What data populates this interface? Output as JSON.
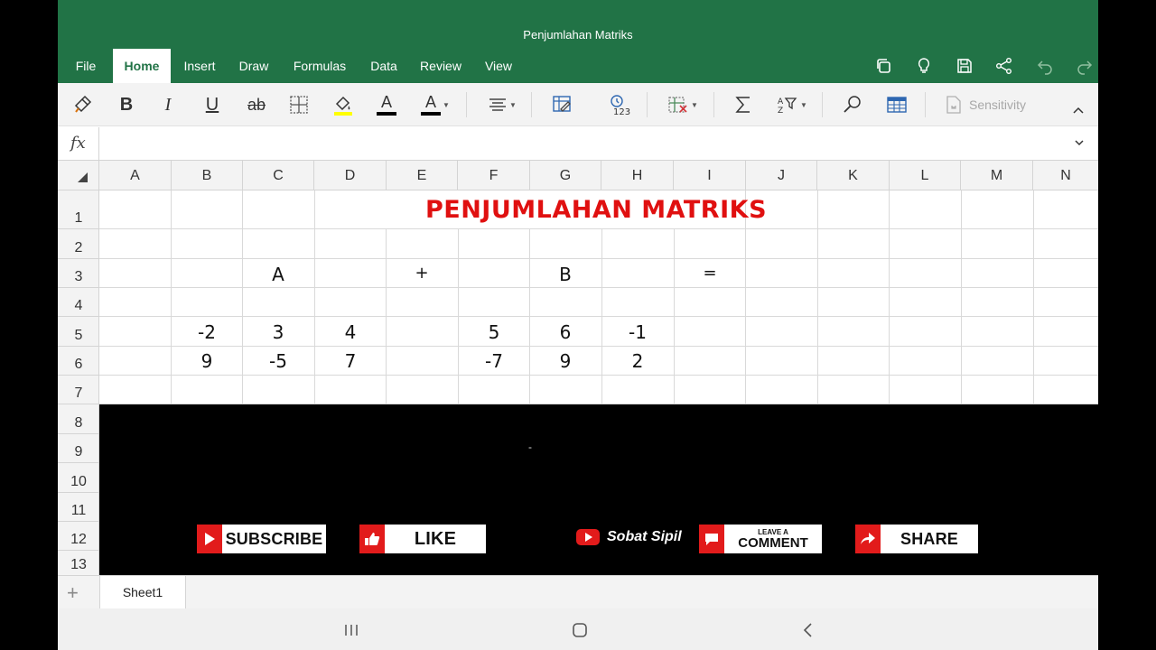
{
  "app": {
    "title": "Penjumlahan Matriks",
    "accent": "#217346"
  },
  "ribbon": {
    "tabs": [
      {
        "label": "File",
        "active": false
      },
      {
        "label": "Home",
        "active": true
      },
      {
        "label": "Insert",
        "active": false
      },
      {
        "label": "Draw",
        "active": false
      },
      {
        "label": "Formulas",
        "active": false
      },
      {
        "label": "Data",
        "active": false
      },
      {
        "label": "Review",
        "active": false
      },
      {
        "label": "View",
        "active": false
      }
    ],
    "right_icons": [
      "copy-icon",
      "lightbulb-icon",
      "save-icon",
      "share-icon",
      "undo-icon",
      "redo-icon"
    ]
  },
  "toolbar": {
    "items": [
      "format-painter-icon",
      "bold-icon",
      "italic-icon",
      "underline-icon",
      "strikethrough-icon",
      "borders-icon",
      "fill-color-icon",
      "font-color-icon",
      "font-color-dropdown-icon",
      "align-icon",
      "wrap-text-icon",
      "number-format-icon",
      "insert-delete-icon",
      "autosum-icon",
      "sort-filter-icon",
      "find-icon",
      "format-as-table-icon",
      "sensitivity-icon",
      "collapse-ribbon-icon"
    ],
    "bold_label": "B",
    "italic_label": "I",
    "underline_label": "U",
    "strike_label": "ab",
    "font_color_label": "A",
    "number_format_label": "123",
    "sensitivity_label": "Sensitivity",
    "fill_color": "#ffff00",
    "font_color": "#000000",
    "font_color_2": "#c00000"
  },
  "formula_bar": {
    "fx_label": "fx",
    "value": ""
  },
  "grid": {
    "columns": [
      "A",
      "B",
      "C",
      "D",
      "E",
      "F",
      "G",
      "H",
      "I",
      "J",
      "K",
      "L",
      "M",
      "N"
    ],
    "rows": [
      "1",
      "2",
      "3",
      "4",
      "5",
      "6",
      "7",
      "8",
      "9",
      "10",
      "11",
      "12",
      "13"
    ],
    "title": "PENJUMLAHAN MATRIKS",
    "title_color": "#e01010",
    "row3": {
      "C": "A",
      "E": "+",
      "G": "B",
      "I": "="
    },
    "matrix_a": [
      [
        "-2",
        "3",
        "4"
      ],
      [
        "9",
        "-5",
        "7"
      ]
    ],
    "matrix_b": [
      [
        "5",
        "6",
        "-1"
      ],
      [
        "-7",
        "9",
        "2"
      ]
    ]
  },
  "overlay": {
    "dash": "-",
    "subscribe": "SUBSCRIBE",
    "like": "LIKE",
    "brand": "Sobat Sipil",
    "comment_top": "LEAVE A",
    "comment": "COMMENT",
    "share": "SHARE",
    "button_color": "#e21b1b"
  },
  "sheets": {
    "active": "Sheet1",
    "add_icon": "plus-icon"
  },
  "navbar": [
    "recent-apps-icon",
    "home-icon",
    "back-icon"
  ]
}
